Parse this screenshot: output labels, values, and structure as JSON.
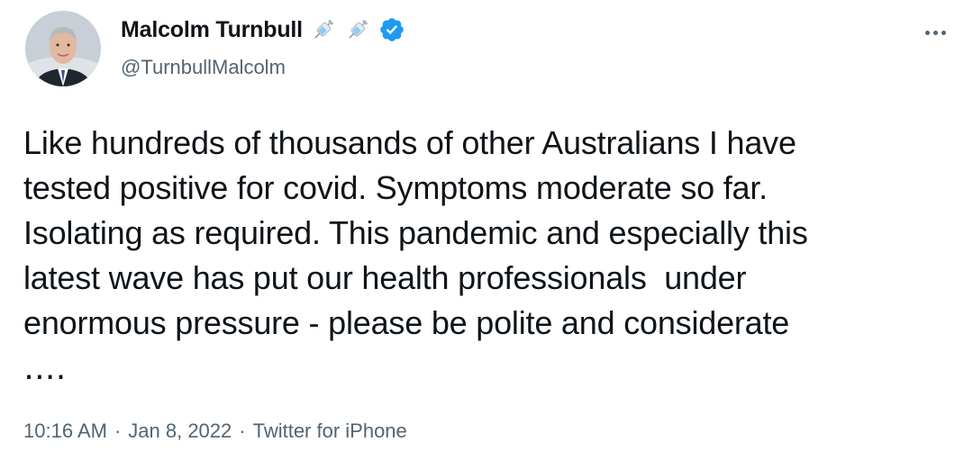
{
  "author": {
    "display_name": "Malcolm Turnbull",
    "handle": "@TurnbullMalcolm",
    "name_emojis": [
      "syringe-icon",
      "syringe-icon"
    ],
    "verified": true
  },
  "tweet": {
    "text": "Like hundreds of thousands of other Australians I have\ntested positive for covid. Symptoms moderate so far.\nIsolating as required. This pandemic and especially this\nlatest wave has put our health professionals  under\nenormous pressure - please be polite and considerate\n․․․․",
    "time": "10:16 AM",
    "date": "Jan 8, 2022",
    "source": "Twitter for iPhone",
    "separator": "·"
  },
  "colors": {
    "text_primary": "#0f1419",
    "text_secondary": "#536471",
    "verified_blue": "#1d9bf0",
    "background": "#ffffff"
  },
  "icons": {
    "more": "more-horizontal-icon",
    "verified": "verified-badge-icon"
  }
}
